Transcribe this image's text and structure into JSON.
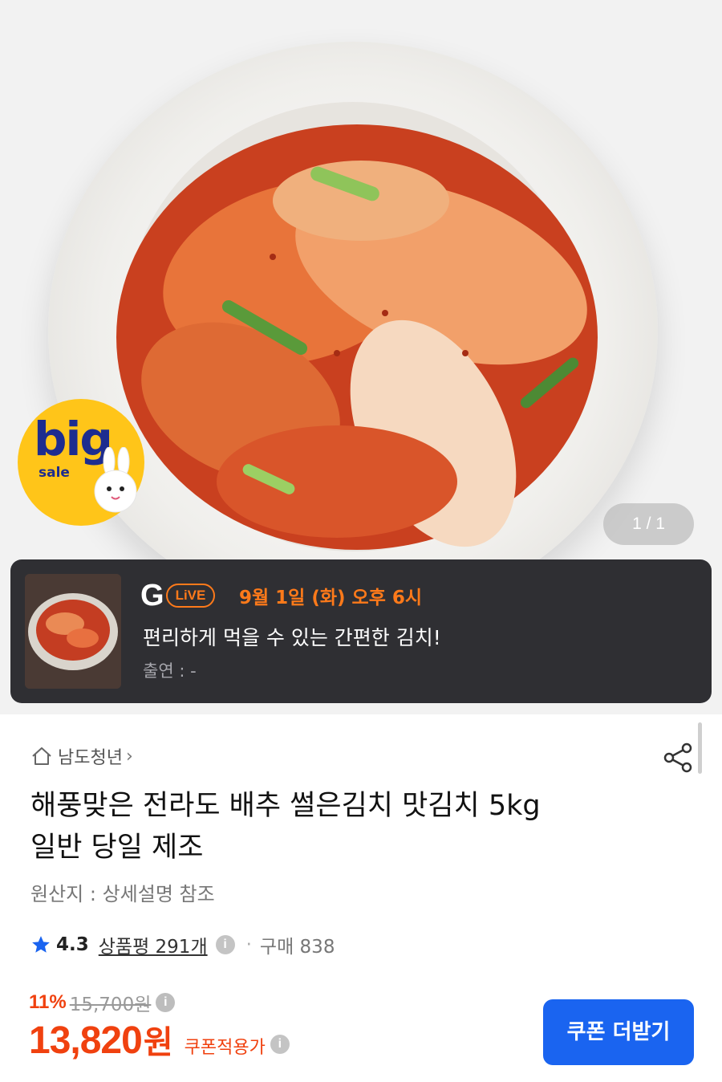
{
  "gallery": {
    "counter": "1 / 1",
    "badge": {
      "big": "big",
      "sale": "sale"
    }
  },
  "live": {
    "g": "G",
    "tag": "LiVE",
    "date": "9월 1일 (화) 오후 6시",
    "title": "편리하게 먹을 수 있는 간편한 김치!",
    "cast": "출연 : -"
  },
  "product": {
    "seller": "남도청년",
    "seller_chevron": "›",
    "title_line1": "해풍맞은 전라도 배추 썰은김치 맛김치 5kg",
    "title_line2": "일반 당일 제조",
    "origin": "원산지 : 상세설명 참조",
    "rating": "4.3",
    "reviews": "상품평 291개",
    "separator": "·",
    "purchase": "구매 838",
    "discount_rate": "11%",
    "original_price": "15,700원",
    "price": "13,820",
    "price_unit": "원",
    "coupon_label": "쿠폰적용가",
    "coupon_button": "쿠폰 더받기",
    "info_glyph": "i"
  },
  "colors": {
    "accent_red": "#f0410f",
    "live_orange": "#ff7a1a",
    "button_blue": "#1a64f0",
    "star_blue": "#1a64f0",
    "badge_yellow": "#ffc519"
  },
  "icons": [
    "home-icon",
    "share-icon",
    "star-icon",
    "info-icon",
    "bunny-icon"
  ]
}
